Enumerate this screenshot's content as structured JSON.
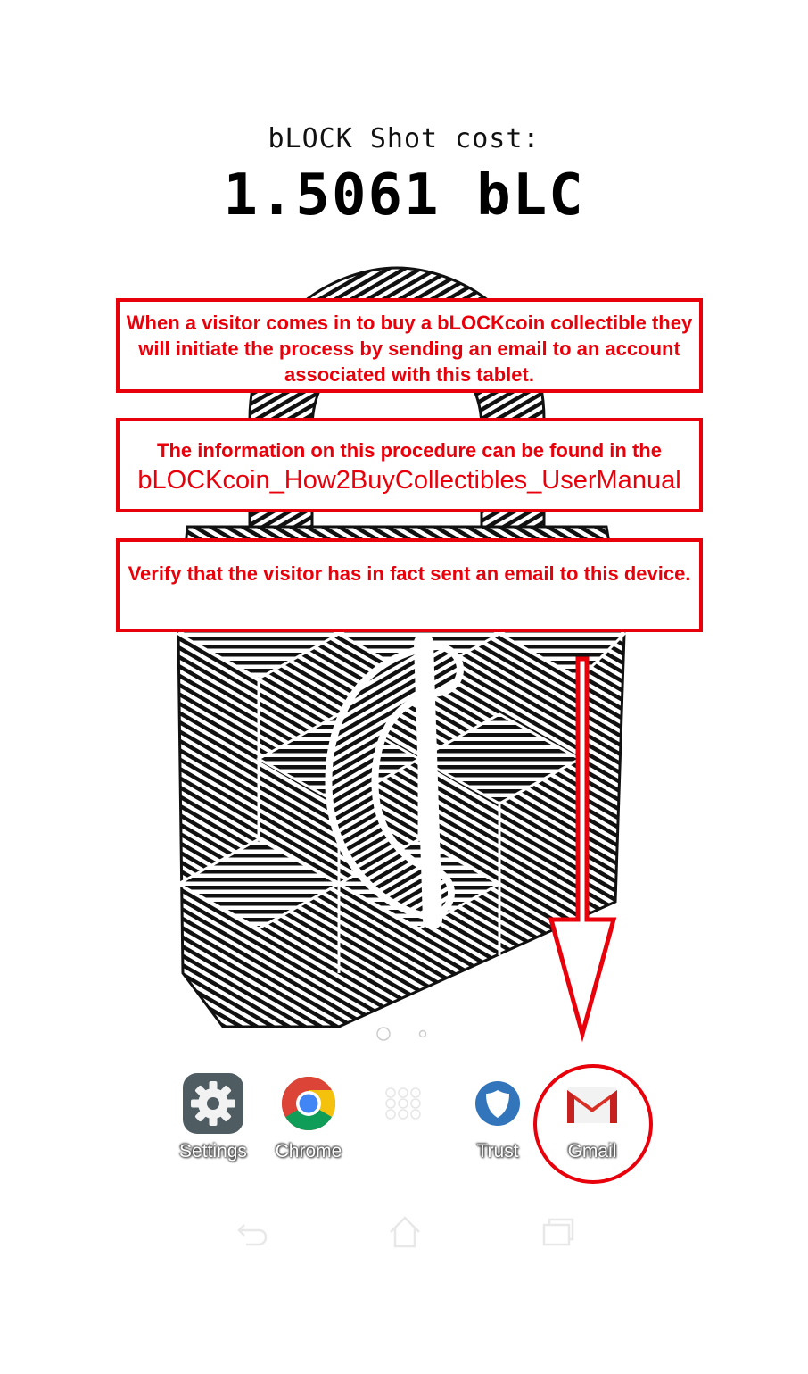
{
  "cost": {
    "label": "bLOCK Shot cost:",
    "value": "1.5061 bLC"
  },
  "callouts": {
    "first": "When a visitor comes in to buy a bLOCKcoin collectible they will initiate the process by sending an email to an account associated with this tablet.",
    "second_intro": "The information on this procedure can be found in the",
    "second_manual": "bLOCKcoin_How2BuyCollectibles_UserManual",
    "third": "Verify that the visitor has in fact sent an email to this device."
  },
  "dock": {
    "apps": [
      {
        "label": "Settings",
        "icon": "gear-icon"
      },
      {
        "label": "Chrome",
        "icon": "chrome-icon"
      },
      {
        "label": "",
        "icon": "app-drawer-icon"
      },
      {
        "label": "Trust",
        "icon": "shield-icon"
      },
      {
        "label": "Gmail",
        "icon": "gmail-icon"
      }
    ]
  },
  "home_screen": {
    "page_count": 2,
    "current_page": 1
  },
  "colors": {
    "annotation_red": "#e8000b",
    "lock_black": "#111111"
  }
}
